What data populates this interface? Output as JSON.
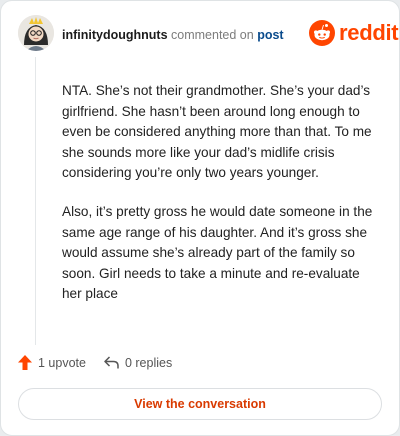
{
  "header": {
    "username": "infinitydoughnuts",
    "commented_text": "commented on",
    "post_link": "post"
  },
  "brand": {
    "wordmark": "reddit",
    "accent_color": "#ff4500"
  },
  "comment": {
    "paragraphs": [
      "NTA. She’s not their grandmother. She’s your dad’s girlfriend. She hasn’t been around long enough to even be considered anything more than that. To me she sounds more like your dad’s midlife crisis considering you’re only two years younger.",
      "Also, it’s pretty gross he would date someone in the same age range of his daughter. And it’s gross she would assume she’s already part of the family so soon. Girl needs to take a minute and re-evaluate her place"
    ]
  },
  "actions": {
    "upvote_label": "1 upvote",
    "replies_label": "0 replies"
  },
  "footer": {
    "view_label": "View the conversation"
  }
}
